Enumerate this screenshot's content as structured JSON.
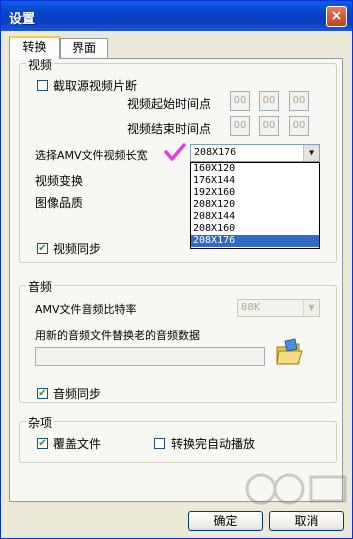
{
  "window": {
    "title": "设置",
    "close_label": "×"
  },
  "tabs": [
    {
      "label": "转换",
      "active": true
    },
    {
      "label": "界面",
      "active": false
    }
  ],
  "video": {
    "group_label": "视频",
    "extract_label": "截取源视频片断",
    "extract_checked": false,
    "start_label": "视频起始时间点",
    "end_label": "视频结束时间点",
    "time_start": [
      "00",
      "00",
      "00"
    ],
    "time_end": [
      "00",
      "00",
      "00"
    ],
    "size_label": "选择AMV文件视频长宽",
    "size_selected": "208X176",
    "size_options": [
      "160X120",
      "176X144",
      "192X160",
      "208X120",
      "208X144",
      "208X160",
      "208X176"
    ],
    "transform_label": "视频变换",
    "quality_label": "图像品质",
    "sync_label": "视频同步",
    "sync_checked": true
  },
  "audio": {
    "group_label": "音频",
    "bitrate_label": "AMV文件音频比特率",
    "bitrate_value": "88K",
    "replace_label": "用新的音频文件替换老的音频数据",
    "replace_path": "",
    "sync_label": "音频同步",
    "sync_checked": true
  },
  "misc": {
    "group_label": "杂项",
    "overwrite_label": "覆盖文件",
    "overwrite_checked": true,
    "autoplay_label": "转换完自动播放",
    "autoplay_checked": false
  },
  "buttons": {
    "ok": "确定",
    "cancel": "取消"
  },
  "colors": {
    "titlebar": "#0842c8",
    "selection": "#316ac5",
    "check": "#21a121",
    "annotation": "#e83ee0"
  }
}
